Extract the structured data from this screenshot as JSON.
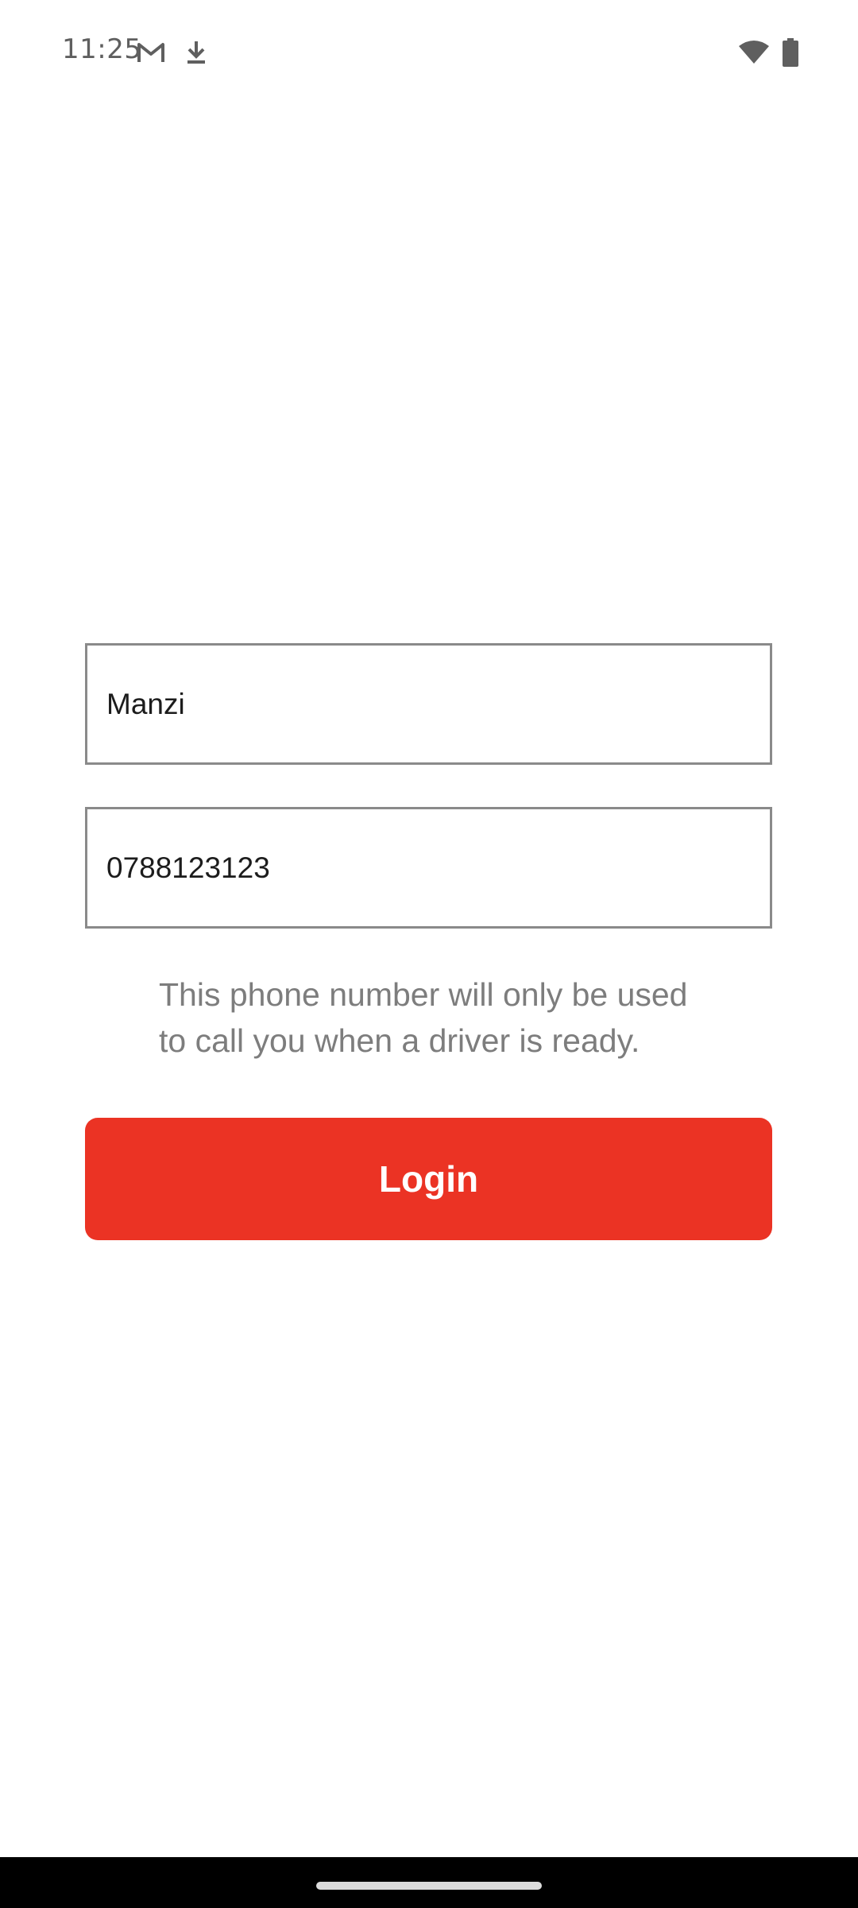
{
  "status_bar": {
    "time": "11:25",
    "icons": [
      "gmail-icon",
      "download-icon",
      "wifi-icon",
      "battery-icon"
    ]
  },
  "form": {
    "name_value": "Manzi",
    "phone_value": "0788123123",
    "helper_text": "This phone number will only be used to call you when a driver is ready.",
    "login_label": "Login"
  },
  "colors": {
    "accent": "#eb3324",
    "helper_text": "#7d7d7d",
    "field_border": "#8a8a8a"
  }
}
